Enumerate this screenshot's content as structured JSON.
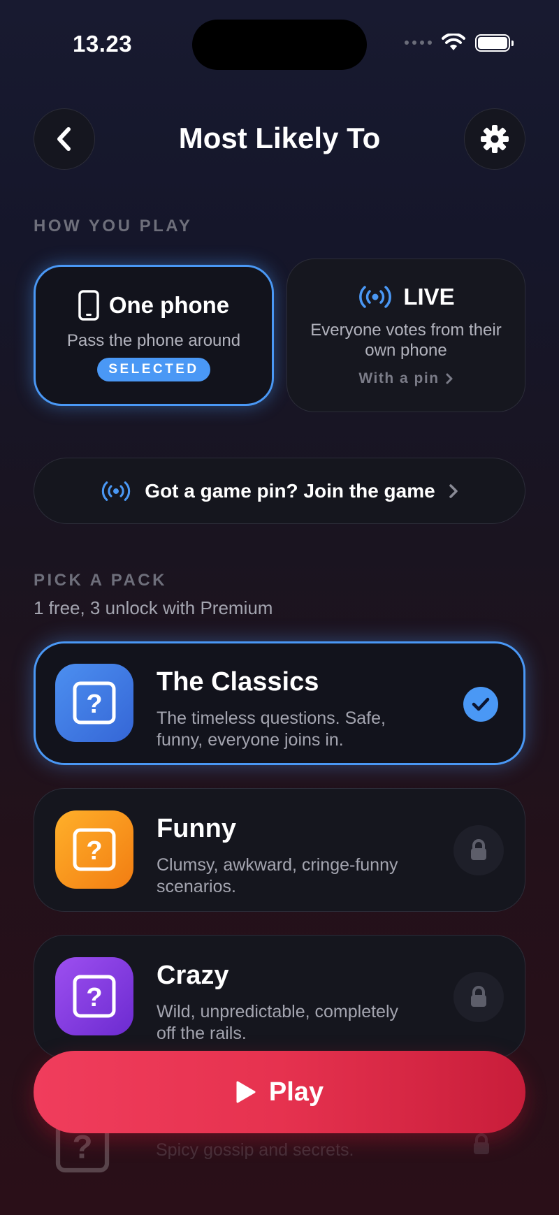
{
  "status": {
    "time": "13.23"
  },
  "header": {
    "title": "Most Likely To",
    "back_icon": "chevron-left-icon",
    "settings_icon": "gear-icon"
  },
  "play_mode": {
    "section_label": "HOW YOU PLAY",
    "one_phone": {
      "title": "One phone",
      "desc": "Pass the phone around",
      "badge": "SELECTED",
      "icon": "phone-icon"
    },
    "live": {
      "title": "LIVE",
      "desc": "Everyone votes from their own phone",
      "link": "With a pin",
      "icon": "broadcast-icon"
    }
  },
  "join": {
    "label": "Got a game pin? Join the game"
  },
  "packs": {
    "section_label": "PICK A PACK",
    "subtitle": "1 free, 3 unlock with Premium",
    "items": [
      {
        "title": "The Classics",
        "desc": "The timeless questions. Safe, funny, everyone joins in.",
        "state": "selected",
        "color": "#3f7fe6"
      },
      {
        "title": "Funny",
        "desc": "Clumsy, awkward, cringe-funny scenarios.",
        "state": "locked",
        "color": "#f7941d"
      },
      {
        "title": "Crazy",
        "desc": "Wild, unpredictable, completely off the rails.",
        "state": "locked",
        "color": "#8a3fe0"
      },
      {
        "title": "",
        "desc": "Spicy gossip and secrets.",
        "state": "locked",
        "color": "#e0315a"
      }
    ]
  },
  "play_button": {
    "label": "Play"
  },
  "colors": {
    "accent": "#4a98f5",
    "play": "#e6324f"
  }
}
